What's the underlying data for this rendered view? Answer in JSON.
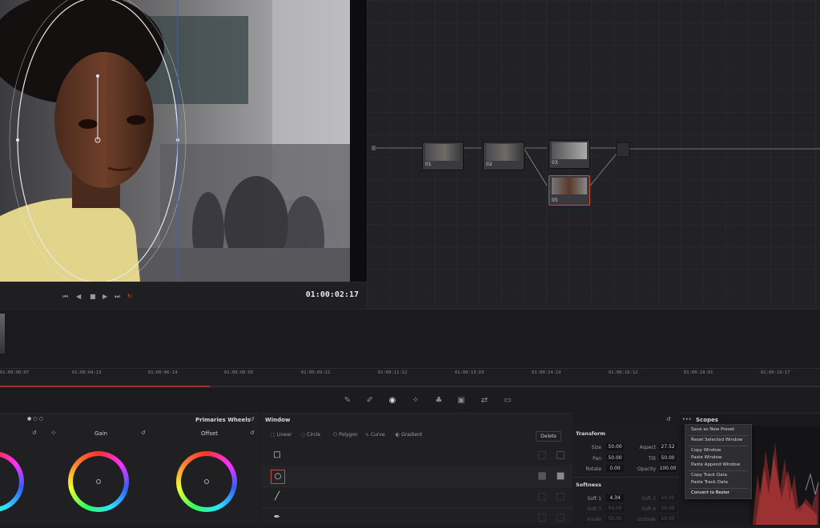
{
  "viewer": {
    "timecode": "01:00:02:17"
  },
  "transport": {
    "icons": [
      "skip-back-icon",
      "step-back-icon",
      "stop-icon",
      "play-icon",
      "skip-forward-icon",
      "loop-icon"
    ]
  },
  "nodes": [
    {
      "id": "01",
      "label": "01"
    },
    {
      "id": "02",
      "label": "02"
    },
    {
      "id": "03",
      "label": "03"
    },
    {
      "id": "05",
      "label": "05"
    }
  ],
  "timeline": {
    "ticks": [
      "01:00:00:07",
      "01:00:04:23",
      "01:00:06:14",
      "01:00:08:05",
      "01:00:09:21",
      "01:00:11:12",
      "01:00:13:03",
      "01:00:14:19",
      "01:00:16:12",
      "01:00:18:01",
      "01:00:19:17"
    ]
  },
  "primaries": {
    "title": "Primaries Wheels",
    "wheels": [
      {
        "label": "Gain"
      },
      {
        "label": "Offset"
      }
    ]
  },
  "window": {
    "title": "Window",
    "tabs": [
      "Linear",
      "Circle",
      "Polygon",
      "Curve",
      "Gradient"
    ],
    "delete_label": "Delete"
  },
  "transform": {
    "title": "Transform",
    "fields": [
      {
        "label": "Size",
        "value": "50.00"
      },
      {
        "label": "Aspect",
        "value": "27.52"
      },
      {
        "label": "Pan",
        "value": "50.00"
      },
      {
        "label": "Tilt",
        "value": "50.00"
      },
      {
        "label": "Rotate",
        "value": "0.00"
      },
      {
        "label": "Opacity",
        "value": "100.00"
      }
    ],
    "softness_title": "Softness",
    "softness": [
      {
        "label": "Soft 1",
        "value": "4.34"
      },
      {
        "label": "Soft 2",
        "value": "50.00"
      },
      {
        "label": "Soft 3",
        "value": "50.00"
      },
      {
        "label": "Soft 4",
        "value": "50.00"
      },
      {
        "label": "Inside",
        "value": "50.00"
      },
      {
        "label": "Outside",
        "value": "50.00"
      }
    ]
  },
  "scopes": {
    "title": "Scopes"
  },
  "context_menu": {
    "items": [
      "Save as New Preset",
      "Reset Selected Window",
      "Copy Window",
      "Paste Window",
      "Paste Append Window",
      "Copy Track Data",
      "Paste Track Data",
      "Convert to Bezier"
    ]
  },
  "colors": {
    "accent_red": "#c0503a",
    "bg": "#1c1c1f"
  }
}
